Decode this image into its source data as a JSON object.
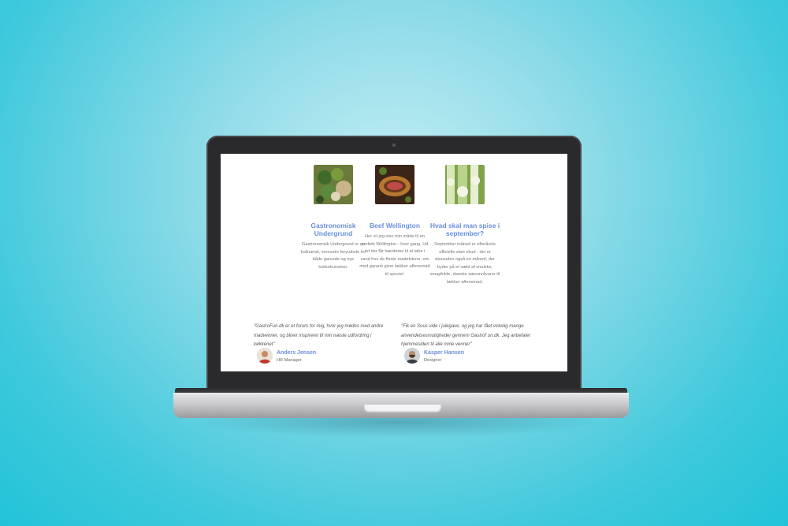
{
  "colors": {
    "accent": "#6a8fdc",
    "background": "#35c8dc"
  },
  "cards": [
    {
      "title": "Gastronomisk Undergrund",
      "body": "Gastronomisk Undergrund er en kulinarisk, innovativ feryudsde for både garvede og nye kokkekunstner.",
      "image_icon": "vegetables-icon"
    },
    {
      "title": "Beef Wellington",
      "body": "Her vil jeg vise min måde til en perfekt Wellington - hver gang. Ud ref der får hærdeme til at løbe i vand hos de fleste madelskere, om med garanti giver lækker aftensmad til speciel.",
      "image_icon": "beef-wellington-icon"
    },
    {
      "title": "Hvad skal man spise i september?",
      "body": "September måned er efterårets officielle start ekud - det er dessuden også en måned, der byder på et væld af smukke, smagfulde, danske sæsonråvarer til lækker aftensmad.",
      "image_icon": "leek-icon"
    }
  ],
  "testimonials": [
    {
      "quote": "\"GastroFun.dk er et forum for mig, hvor jeg mødes med andre madvenner, og bliver inspireret til min næste udfordring i køkkenet\"",
      "name": "Anders Jensen",
      "role": "HR Manager",
      "avatar_icon": "avatar-icon"
    },
    {
      "quote": "\"Fik en Sous vide i julegave, og jeg har fået virkelig mange anvendelsesmuligheder gennem Gastrof un.dk. Jeg anbefaler hjemmesiden til alle mine venner\"",
      "name": "Kasper Hansen",
      "role": "Designer",
      "avatar_icon": "avatar-icon"
    }
  ]
}
